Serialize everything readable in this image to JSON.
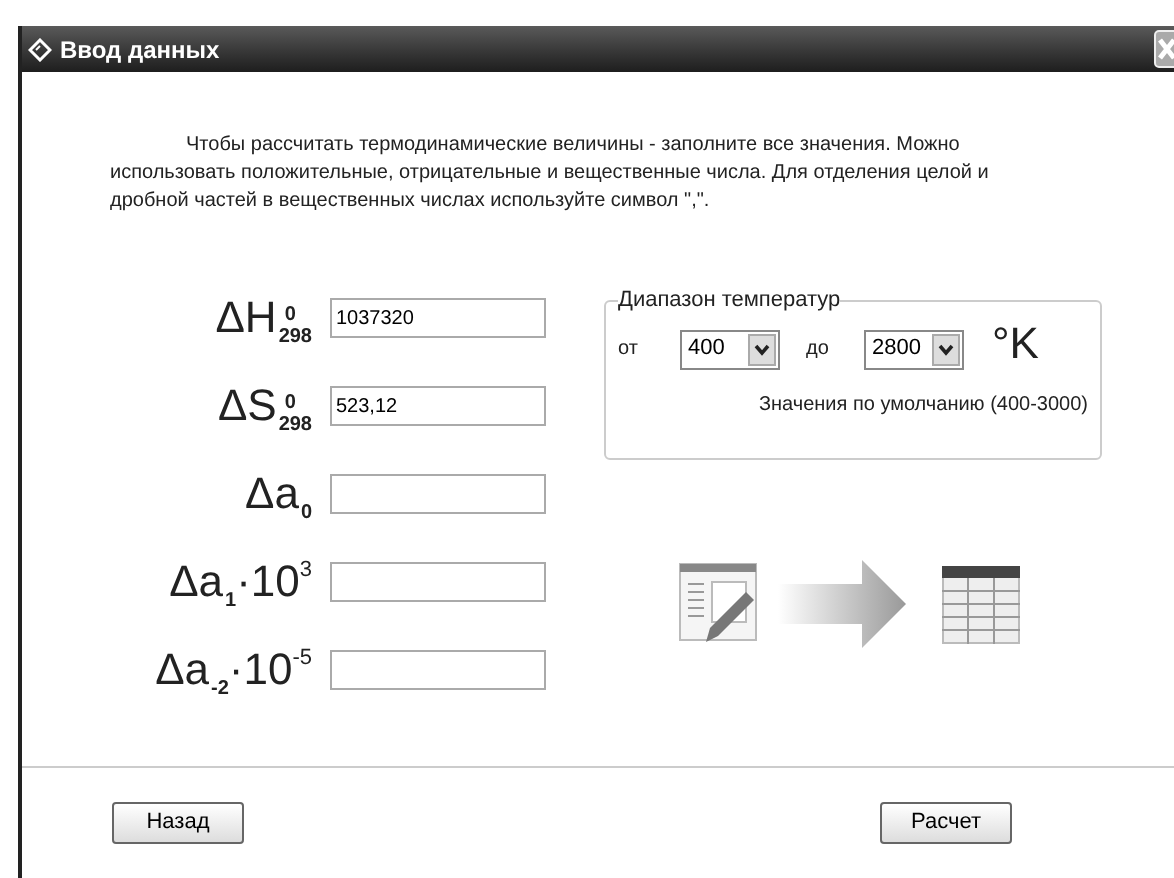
{
  "window": {
    "title": "Ввод данных"
  },
  "instructions": "Чтобы рассчитать термодинамические величины - заполните все значения. Можно использовать положительные, отрицательные и вещественные числа. Для отделения целой и дробной частей в вещественных числах используйте символ \",\".",
  "fields": [
    {
      "symbol": "ΔH",
      "sup": "0",
      "sub": "298",
      "value": "1037320"
    },
    {
      "symbol": "ΔS",
      "sup": "0",
      "sub": "298",
      "value": "523,12"
    },
    {
      "symbol": "Δa",
      "sub": "0"
    },
    {
      "symbol": "Δa",
      "sub": "1",
      "factor": "·10",
      "factor_sup": "3"
    },
    {
      "symbol": "Δa",
      "sub": "-2",
      "factor": "·10",
      "factor_sup": "-5"
    }
  ],
  "temperature_range": {
    "title": "Диапазон температур",
    "from_label": "от",
    "from_value": "400",
    "to_label": "до",
    "to_value": "2800",
    "unit": "°K",
    "default_note": "Значения по умолчанию (400-3000)"
  },
  "buttons": {
    "back": "Назад",
    "calculate": "Расчет"
  }
}
